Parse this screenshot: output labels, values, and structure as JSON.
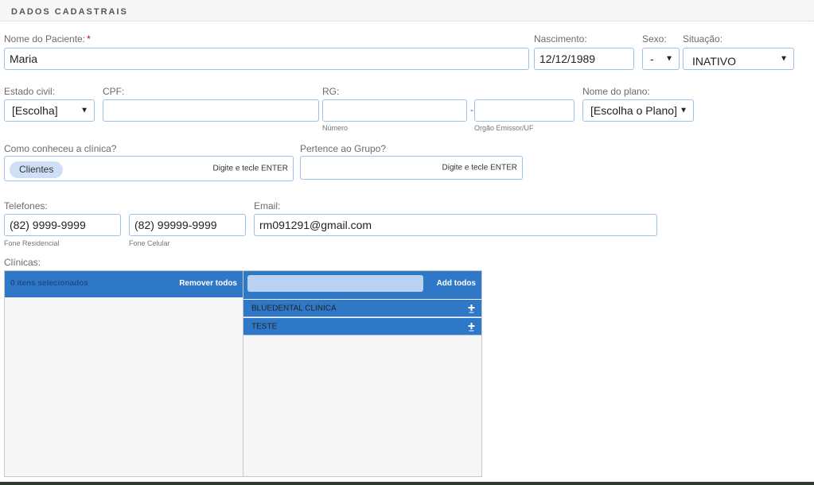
{
  "section": {
    "title": "DADOS CADASTRAIS"
  },
  "patient": {
    "name_label": "Nome do Paciente:",
    "required_mark": "*",
    "name_value": "Maria",
    "birth_label": "Nascimento:",
    "birth_value": "12/12/1989",
    "sex_label": "Sexo:",
    "sex_value": "-",
    "status_label": "Situação:",
    "status_value": "INATIVO"
  },
  "row2": {
    "civil_label": "Estado civil:",
    "civil_value": "[Escolha]",
    "cpf_label": "CPF:",
    "cpf_value": "",
    "rg_label": "RG:",
    "rg_number_value": "",
    "rg_number_caption": "Número",
    "rg_separator": "-",
    "rg_issuer_value": "",
    "rg_issuer_caption": "Orgão Emissor/UF",
    "plan_label": "Nome do plano:",
    "plan_value": "[Escolha o Plano]"
  },
  "row3": {
    "how_label": "Como conheceu a clínica?",
    "how_tag": "Clientes",
    "how_hint": "Digite e tecle ENTER",
    "group_label": "Pertence ao Grupo?",
    "group_hint": "Digite e tecle ENTER"
  },
  "contact": {
    "phones_label": "Telefones:",
    "phone_home_value": "(82) 9999-9999",
    "phone_home_caption": "Fone Residencial",
    "phone_mobile_value": "(82) 99999-9999",
    "phone_mobile_caption": "Fone Celular",
    "email_label": "Email:",
    "email_value": "rm091291@gmail.com"
  },
  "clinics": {
    "label": "Clínicas:",
    "selected_count": "0 itens selecionados",
    "remove_all": "Remover todos",
    "search_value": "",
    "add_all": "Add todos",
    "available": [
      "BLUEDENTAL CLINICA",
      "TESTE"
    ],
    "icon": "plus-icon"
  },
  "colors": {
    "accent": "#2f78c8",
    "field_border": "#9fc0e8",
    "required": "#cc0000"
  }
}
